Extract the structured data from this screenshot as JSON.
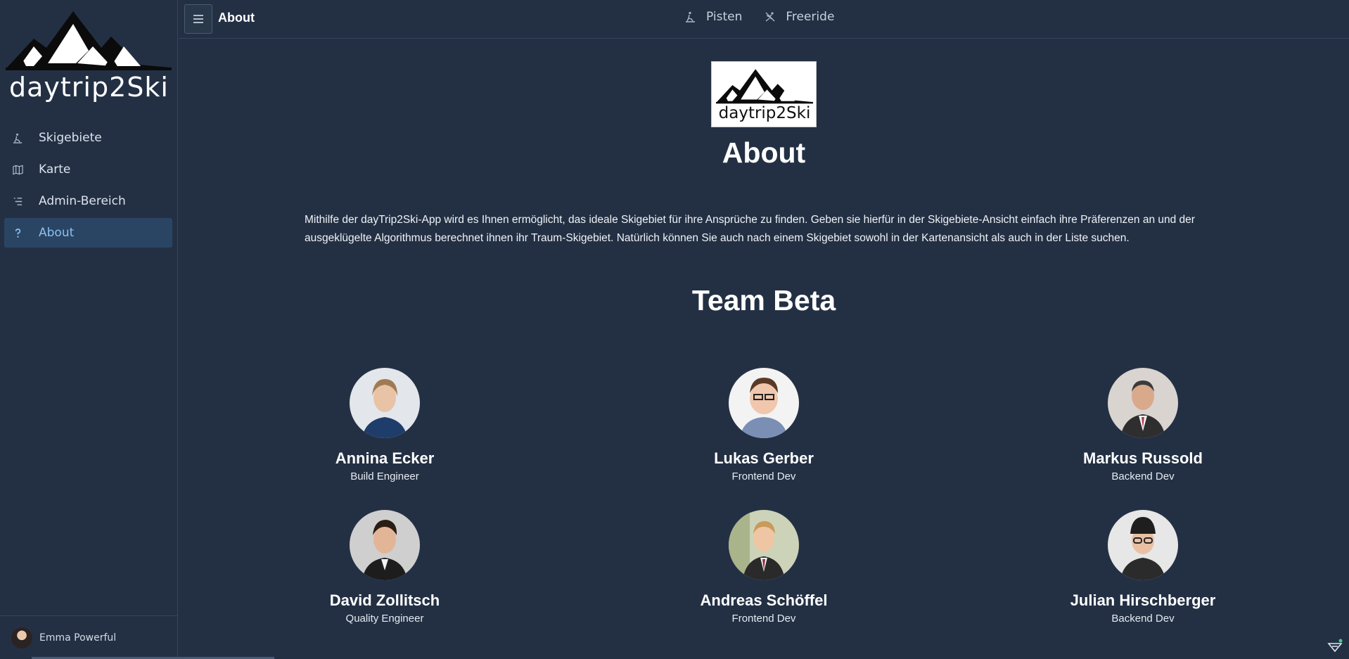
{
  "sidebar": {
    "brand_name": "daytrip2Ski",
    "items": [
      {
        "label": "Skigebiete",
        "icon": "skier-icon",
        "active": false
      },
      {
        "label": "Karte",
        "icon": "map-icon",
        "active": false
      },
      {
        "label": "Admin-Bereich",
        "icon": "list-icon",
        "active": false
      },
      {
        "label": "About",
        "icon": "question-icon",
        "active": true
      }
    ],
    "user": {
      "name": "Emma Powerful"
    }
  },
  "topbar": {
    "title": "About",
    "links": [
      {
        "label": "Pisten",
        "icon": "skiing-icon"
      },
      {
        "label": "Freeride",
        "icon": "freeride-icon"
      }
    ]
  },
  "main": {
    "logo_text": "daytrip2Ski",
    "title": "About",
    "intro": "Mithilfe der dayTrip2Ski-App wird es Ihnen ermöglicht, das ideale Skigebiet für ihre Ansprüche zu finden. Geben sie hierfür in der Skigebiete-Ansicht einfach ihre Präferenzen an und der ausgeklügelte Algorithmus berechnet ihnen ihr Traum-Skigebiet. Natürlich können Sie auch nach einem Skigebiet sowohl in der Kartenansicht als auch in der Liste suchen.",
    "team_title": "Team Beta",
    "members": [
      {
        "name": "Annina Ecker",
        "role": "Build Engineer"
      },
      {
        "name": "Lukas Gerber",
        "role": "Frontend Dev"
      },
      {
        "name": "Markus Russold",
        "role": "Backend Dev"
      },
      {
        "name": "David Zollitsch",
        "role": "Quality Engineer"
      },
      {
        "name": "Andreas Schöffel",
        "role": "Frontend Dev"
      },
      {
        "name": "Julian Hirschberger",
        "role": "Backend Dev"
      }
    ]
  },
  "colors": {
    "background": "#233044",
    "active_nav_bg": "#2a4563",
    "active_nav_text": "#8cbff0",
    "border": "#33445c"
  }
}
